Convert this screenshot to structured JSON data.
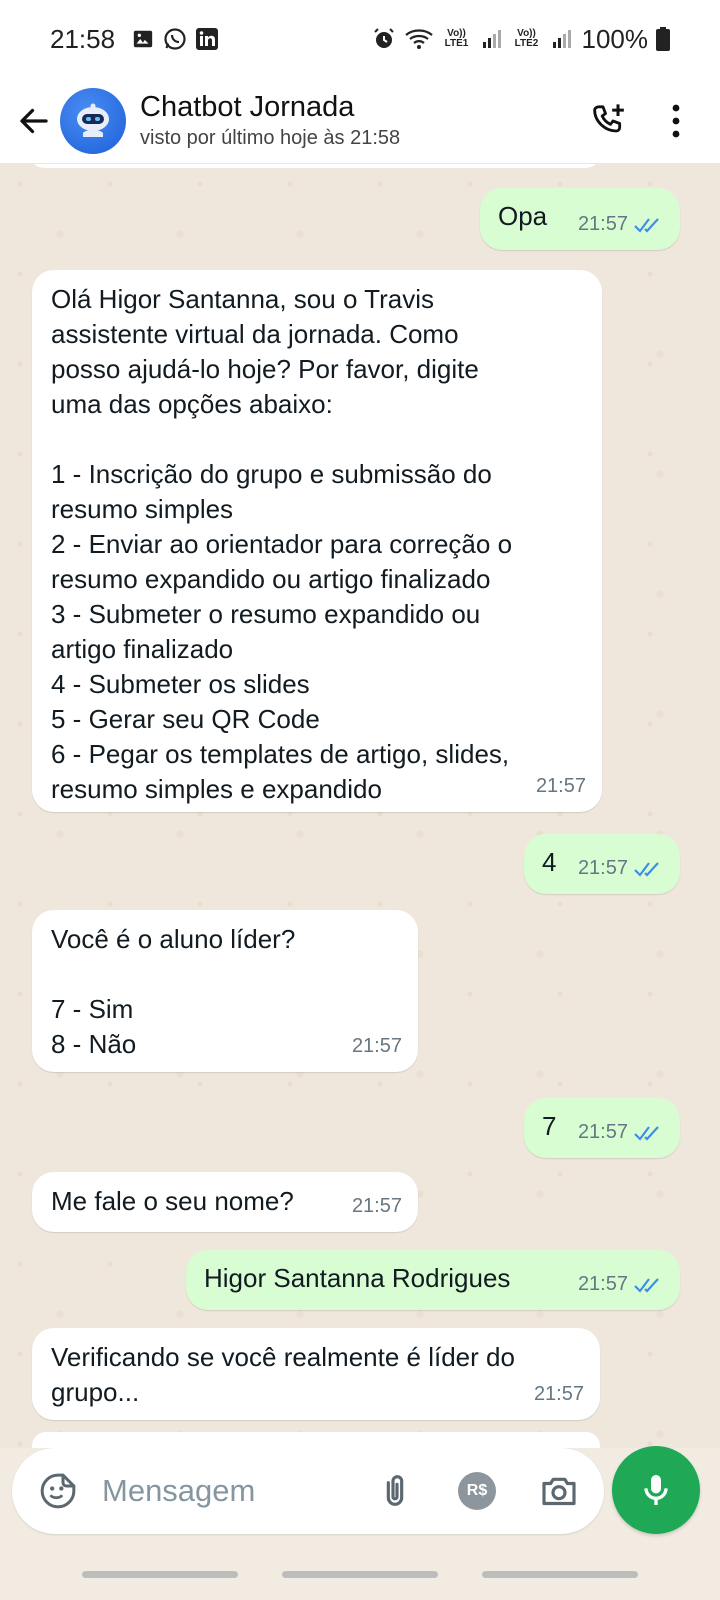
{
  "status_bar": {
    "time": "21:58",
    "battery": "100%",
    "network_1": "Vo)) LTE1",
    "network_2": "Vo)) LTE2",
    "icons": [
      "gallery-icon",
      "whatsapp-icon",
      "linkedin-icon",
      "alarm-icon",
      "wifi-icon",
      "signal-icon",
      "battery-icon"
    ]
  },
  "header": {
    "contact_name": "Chatbot Jornada",
    "contact_status": "visto por último hoje às 21:58"
  },
  "messages": [
    {
      "id": "m1",
      "direction": "out",
      "text": "Opa",
      "time": "21:57",
      "read": true
    },
    {
      "id": "m2",
      "direction": "in",
      "text": "Olá Higor Santanna, sou o Travis\nassistente virtual da jornada. Como\nposso ajudá-lo hoje? Por favor, digite\numa das opções abaixo:\n\n1 - Inscrição do grupo e submissão do\nresumo simples\n2 - Enviar ao orientador para correção o\nresumo expandido ou artigo finalizado\n3 - Submeter o resumo expandido ou\nartigo finalizado\n4 - Submeter os slides\n5 - Gerar seu QR Code\n6 - Pegar os templates de artigo, slides,\nresumo simples e expandido",
      "time": "21:57"
    },
    {
      "id": "m3",
      "direction": "out",
      "text": "4",
      "time": "21:57",
      "read": true
    },
    {
      "id": "m4",
      "direction": "in",
      "text": "Você é o aluno líder?\n\n7 - Sim\n8 - Não",
      "time": "21:57"
    },
    {
      "id": "m5",
      "direction": "out",
      "text": "7",
      "time": "21:57",
      "read": true
    },
    {
      "id": "m6",
      "direction": "in",
      "text": "Me fale o seu nome?",
      "time": "21:57"
    },
    {
      "id": "m7",
      "direction": "out",
      "text": "Higor Santanna Rodrigues",
      "time": "21:57",
      "read": true
    },
    {
      "id": "m8",
      "direction": "in",
      "text": "Verificando se você realmente é líder do\ngrupo...",
      "time": "21:57"
    }
  ],
  "input": {
    "placeholder": "Mensagem",
    "value": "",
    "payment_badge": "R$"
  },
  "colors": {
    "outgoing_bubble": "#d9fdd3",
    "incoming_bubble": "#ffffff",
    "chat_background": "#efe7dc",
    "mic_button": "#1fa855",
    "read_ticks": "#3e8ee8"
  }
}
